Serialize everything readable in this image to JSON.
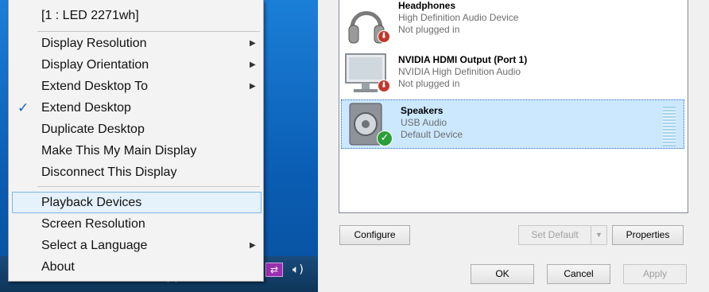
{
  "menu": {
    "monitor_label": "[1 : LED 2271wh]",
    "items": [
      {
        "label": "Display Resolution",
        "submenu": true
      },
      {
        "label": "Display Orientation",
        "submenu": true
      },
      {
        "label": "Extend Desktop To",
        "submenu": true
      },
      {
        "label": "Extend Desktop",
        "checked": true
      },
      {
        "label": "Duplicate Desktop"
      },
      {
        "label": "Make This My Main Display"
      },
      {
        "label": "Disconnect This Display"
      },
      {
        "label": "Playback Devices",
        "highlighted": true
      },
      {
        "label": "Screen Resolution"
      },
      {
        "label": "Select a Language",
        "submenu": true
      },
      {
        "label": "About"
      }
    ],
    "check_glyph": "✓",
    "arrow_glyph": "▶"
  },
  "taskbar": {
    "tray_icons": [
      "usb-device-icon",
      "volume-icon"
    ]
  },
  "devices": [
    {
      "name": "Headphones",
      "driver": "High Definition Audio Device",
      "status": "Not plugged in",
      "icon": "headphones-icon",
      "badge": "unplugged-badge-icon"
    },
    {
      "name": "NVIDIA HDMI Output (Port 1)",
      "driver": "NVIDIA High Definition Audio",
      "status": "Not plugged in",
      "icon": "monitor-icon",
      "badge": "unplugged-badge-icon"
    },
    {
      "name": "Speakers",
      "driver": "USB Audio",
      "status": "Default Device",
      "icon": "speaker-icon",
      "badge": "default-check-badge-icon",
      "selected": true
    }
  ],
  "buttons": {
    "configure": "Configure",
    "set_default": "Set Default",
    "properties": "Properties",
    "ok": "OK",
    "cancel": "Cancel",
    "apply": "Apply"
  },
  "colors": {
    "selection": "#cce8ff",
    "menu_highlight": "#e5f1fb",
    "check": "#1a5fbf"
  }
}
